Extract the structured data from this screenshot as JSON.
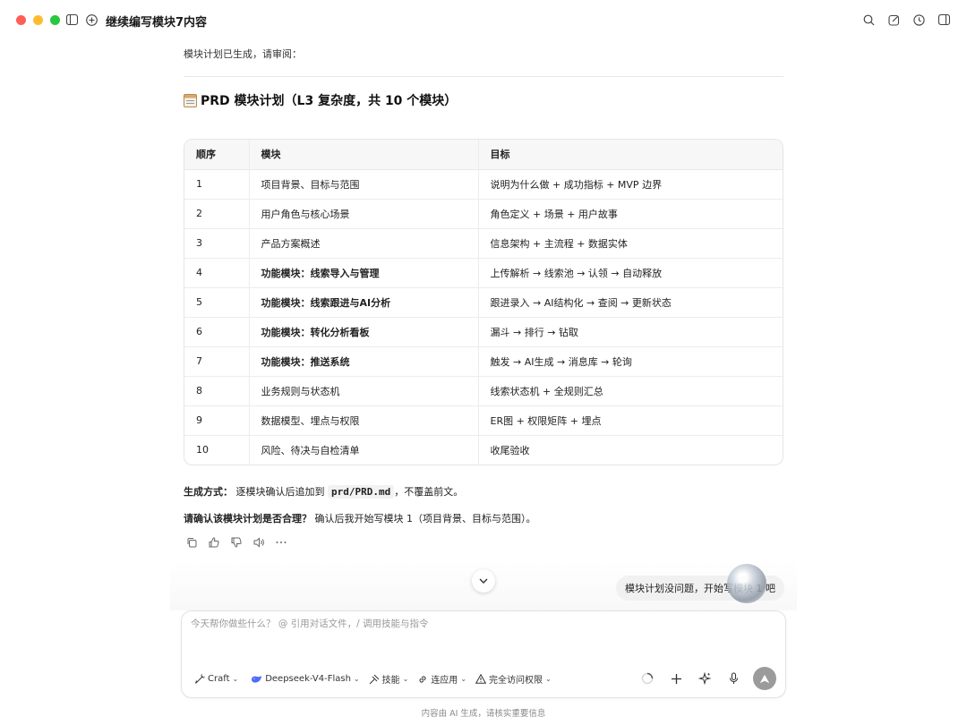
{
  "window": {
    "title": "继续编写模块7内容"
  },
  "message": {
    "intro": "模块计划已生成，请审阅：",
    "plan_title": "PRD 模块计划（L3 复杂度，共 10 个模块）",
    "table": {
      "headers": [
        "顺序",
        "模块",
        "目标"
      ],
      "rows": [
        {
          "order": "1",
          "module": "项目背景、目标与范围",
          "goal": "说明为什么做 + 成功指标 + MVP 边界",
          "bold": false
        },
        {
          "order": "2",
          "module": "用户角色与核心场景",
          "goal": "角色定义 + 场景 + 用户故事",
          "bold": false
        },
        {
          "order": "3",
          "module": "产品方案概述",
          "goal": "信息架构 + 主流程 + 数据实体",
          "bold": false
        },
        {
          "order": "4",
          "module": "功能模块：线索导入与管理",
          "goal": "上传解析 → 线索池 → 认领 → 自动释放",
          "bold": true
        },
        {
          "order": "5",
          "module": "功能模块：线索跟进与AI分析",
          "goal": "跟进录入 → AI结构化 → 查阅 → 更新状态",
          "bold": true
        },
        {
          "order": "6",
          "module": "功能模块：转化分析看板",
          "goal": "漏斗 → 排行 → 钻取",
          "bold": true
        },
        {
          "order": "7",
          "module": "功能模块：推送系统",
          "goal": "触发 → AI生成 → 消息库 → 轮询",
          "bold": true
        },
        {
          "order": "8",
          "module": "业务规则与状态机",
          "goal": "线索状态机 + 全规则汇总",
          "bold": false
        },
        {
          "order": "9",
          "module": "数据模型、埋点与权限",
          "goal": "ER图 + 权限矩阵 + 埋点",
          "bold": false
        },
        {
          "order": "10",
          "module": "风险、待决与自检清单",
          "goal": "收尾验收",
          "bold": false
        }
      ]
    },
    "gen_label": "生成方式：",
    "gen_text_a": "逐模块确认后追加到",
    "gen_code": "prd/PRD.md",
    "gen_text_b": "，不覆盖前文。",
    "confirm_label": "请确认该模块计划是否合理？",
    "confirm_text": "确认后我开始写模块 1（项目背景、目标与范围）。"
  },
  "user_message": "模块计划没问题，开始写模块 1 吧",
  "composer": {
    "placeholder": "今天帮你做些什么？ @ 引用对话文件，/ 调用技能与指令",
    "tools": {
      "mode": "Craft",
      "model": "Deepseek-V4-Flash",
      "skills": "技能",
      "apps": "连应用",
      "permission": "完全访问权限"
    }
  },
  "footer": "内容由 AI 生成，请核实重要信息",
  "colors": {
    "traffic_red": "#ff5f57",
    "traffic_yellow": "#febc2e",
    "traffic_green": "#28c840",
    "send_button": "#9b9b9b"
  }
}
